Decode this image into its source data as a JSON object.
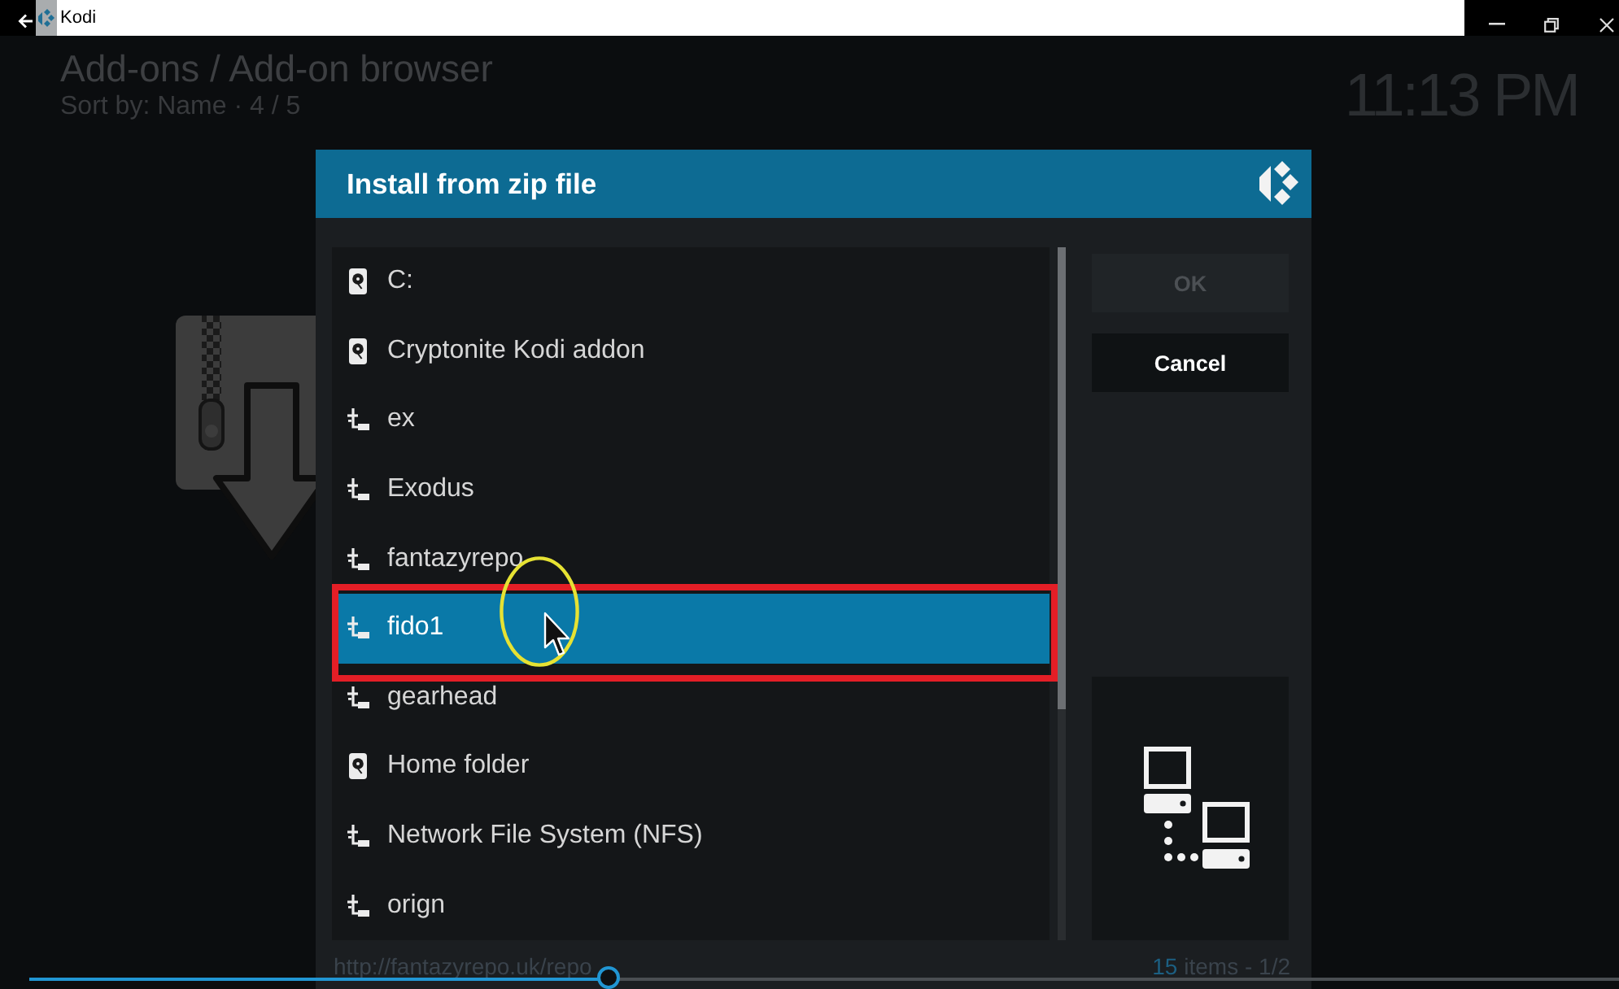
{
  "window": {
    "title": "Kodi"
  },
  "header": {
    "breadcrumb": "Add-ons / Add-on browser",
    "sort": "Sort by: Name · 4 / 5",
    "clock": "11:13 PM"
  },
  "dialog": {
    "title": "Install from zip file",
    "items": [
      {
        "label": "C:",
        "kind": "drive",
        "selected": false
      },
      {
        "label": "Cryptonite Kodi addon",
        "kind": "drive",
        "selected": false
      },
      {
        "label": "ex",
        "kind": "network",
        "selected": false
      },
      {
        "label": "Exodus",
        "kind": "network",
        "selected": false
      },
      {
        "label": "fantazyrepo",
        "kind": "network",
        "selected": false
      },
      {
        "label": "fido1",
        "kind": "network",
        "selected": true
      },
      {
        "label": "gearhead",
        "kind": "network",
        "selected": false
      },
      {
        "label": "Home folder",
        "kind": "drive",
        "selected": false
      },
      {
        "label": "Network File System (NFS)",
        "kind": "network",
        "selected": false
      },
      {
        "label": "orign",
        "kind": "network",
        "selected": false
      }
    ],
    "buttons": [
      {
        "label": "OK",
        "disabled": true
      },
      {
        "label": "Cancel",
        "disabled": false
      }
    ],
    "path": "http://fantazyrepo.uk/repo",
    "item_count": "15",
    "page_info": "items - 1/2"
  },
  "seek_bar": {
    "level": 0.364
  }
}
